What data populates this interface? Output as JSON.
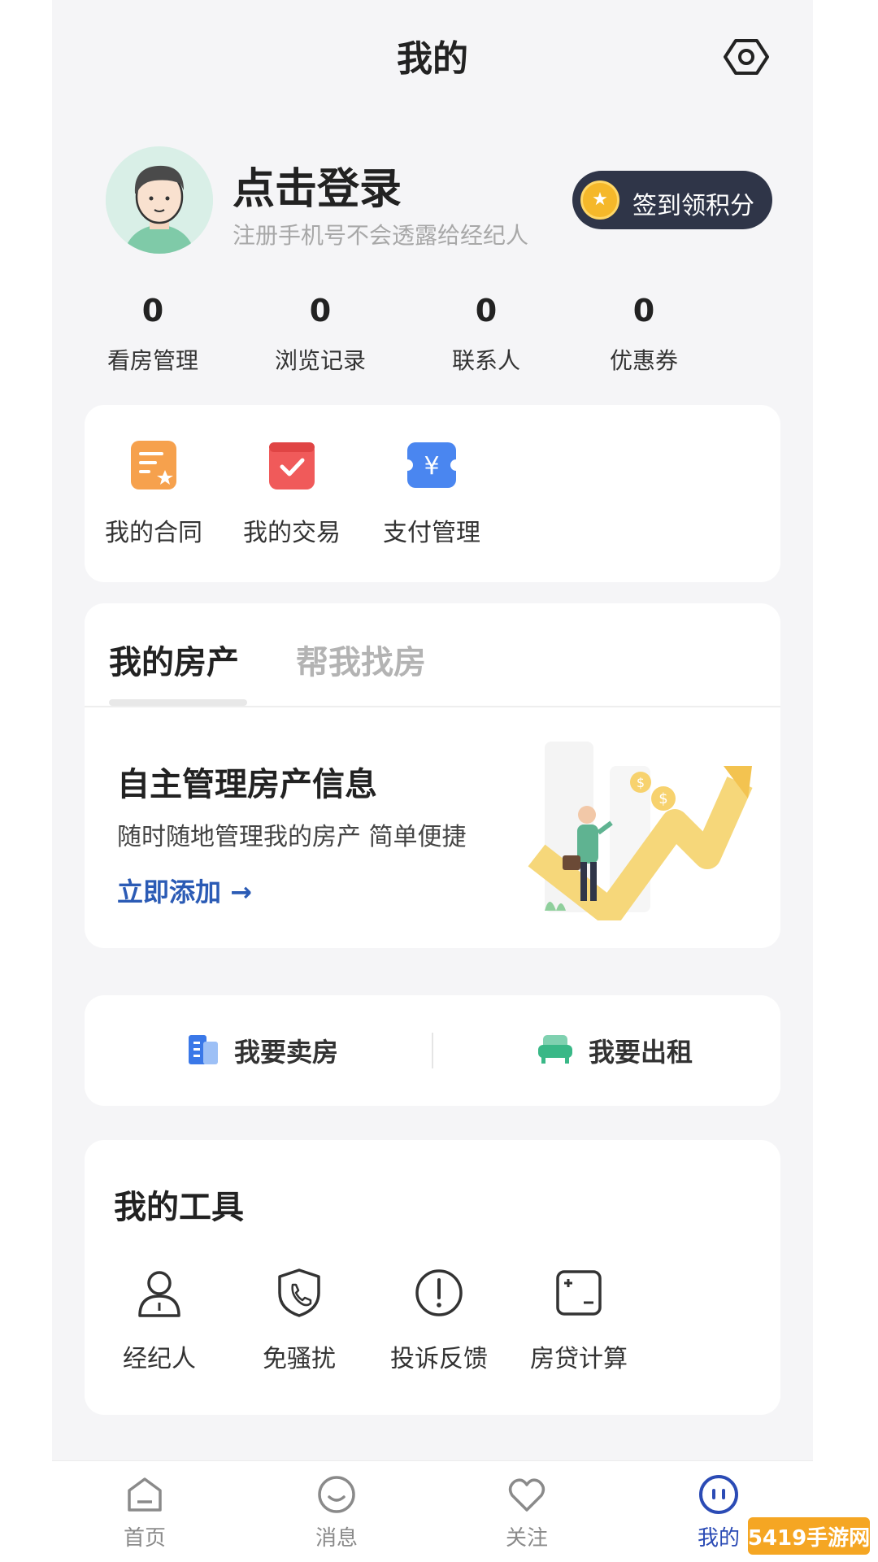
{
  "header": {
    "title": "我的"
  },
  "profile": {
    "login_title": "点击登录",
    "login_subtitle": "注册手机号不会透露给经纪人",
    "signin_label": "签到领积分"
  },
  "stats": [
    {
      "value": "0",
      "label": "看房管理"
    },
    {
      "value": "0",
      "label": "浏览记录"
    },
    {
      "value": "0",
      "label": "联系人"
    },
    {
      "value": "0",
      "label": "优惠券"
    }
  ],
  "quick": [
    {
      "label": "我的合同",
      "icon": "contract-icon"
    },
    {
      "label": "我的交易",
      "icon": "transaction-icon"
    },
    {
      "label": "支付管理",
      "icon": "payment-icon"
    }
  ],
  "property": {
    "tabs": [
      "我的房产",
      "帮我找房"
    ],
    "title": "自主管理房产信息",
    "subtitle": "随时随地管理我的房产 简单便捷",
    "link": "立即添加 →"
  },
  "actions": {
    "sell": "我要卖房",
    "rent": "我要出租"
  },
  "tools": {
    "title": "我的工具",
    "items": [
      {
        "label": "经纪人",
        "icon": "agent-icon"
      },
      {
        "label": "免骚扰",
        "icon": "no-disturb-phone-icon"
      },
      {
        "label": "投诉反馈",
        "icon": "complaint-icon"
      },
      {
        "label": "房贷计算",
        "icon": "calculator-icon"
      }
    ]
  },
  "tabbar": [
    {
      "label": "首页",
      "icon": "home-icon"
    },
    {
      "label": "消息",
      "icon": "message-icon"
    },
    {
      "label": "关注",
      "icon": "heart-icon"
    },
    {
      "label": "我的",
      "icon": "profile-icon",
      "active": true
    }
  ],
  "watermark": {
    "text": "5419手游网"
  },
  "colors": {
    "accent_blue": "#2b5bb5",
    "signin_bg": "#2f3548",
    "page_bg": "#f5f5f7"
  }
}
